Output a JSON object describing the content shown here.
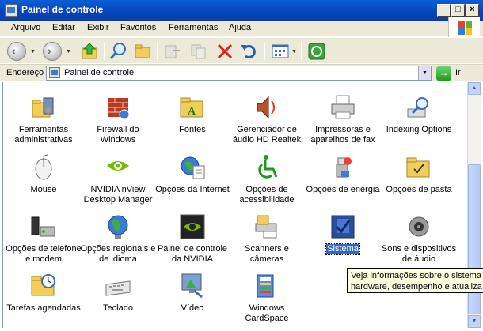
{
  "window": {
    "title": "Painel de controle"
  },
  "menu": [
    "Arquivo",
    "Editar",
    "Exibir",
    "Favoritos",
    "Ferramentas",
    "Ajuda"
  ],
  "address": {
    "label": "Endereço",
    "value": "Painel de controle",
    "go_label": "Ir"
  },
  "items": [
    {
      "label": "Ferramentas administrativas",
      "icon": "admin-tools-icon",
      "selected": false
    },
    {
      "label": "Firewall do Windows",
      "icon": "firewall-icon",
      "selected": false
    },
    {
      "label": "Fontes",
      "icon": "fonts-folder-icon",
      "selected": false
    },
    {
      "label": "Gerenciador de áudio HD Realtek",
      "icon": "speaker-icon",
      "selected": false
    },
    {
      "label": "Impressoras e aparelhos de fax",
      "icon": "printer-icon",
      "selected": false
    },
    {
      "label": "Indexing Options",
      "icon": "indexing-icon",
      "selected": false
    },
    {
      "label": "Mouse",
      "icon": "mouse-icon",
      "selected": false
    },
    {
      "label": "NVIDIA nView Desktop Manager",
      "icon": "nvidia-icon",
      "selected": false
    },
    {
      "label": "Opções da Internet",
      "icon": "internet-globe-icon",
      "selected": false
    },
    {
      "label": "Opções de acessibilidade",
      "icon": "accessibility-icon",
      "selected": false
    },
    {
      "label": "Opções de energia",
      "icon": "power-icon",
      "selected": false
    },
    {
      "label": "Opções de pasta",
      "icon": "folder-options-icon",
      "selected": false
    },
    {
      "label": "Opções de telefone e modem",
      "icon": "phone-modem-icon",
      "selected": false
    },
    {
      "label": "Opções regionais e de idioma",
      "icon": "globe-icon",
      "selected": false
    },
    {
      "label": "Painel de controle da NVIDIA",
      "icon": "nvidia-panel-icon",
      "selected": false
    },
    {
      "label": "Scanners e câmeras",
      "icon": "scanner-icon",
      "selected": false
    },
    {
      "label": "Sistema",
      "icon": "system-icon",
      "selected": true
    },
    {
      "label": "Sons e dispositivos de áudio",
      "icon": "sound-icon",
      "selected": false
    },
    {
      "label": "Tarefas agendadas",
      "icon": "scheduled-tasks-icon",
      "selected": false
    },
    {
      "label": "Teclado",
      "icon": "keyboard-icon",
      "selected": false
    },
    {
      "label": "Vídeo",
      "icon": "display-icon",
      "selected": false
    },
    {
      "label": "Windows CardSpace",
      "icon": "cardspace-icon",
      "selected": false
    }
  ],
  "tooltip": {
    "line1": "Veja informações sobre o sistema d",
    "line2": "hardware, desempenho e atualiza"
  }
}
